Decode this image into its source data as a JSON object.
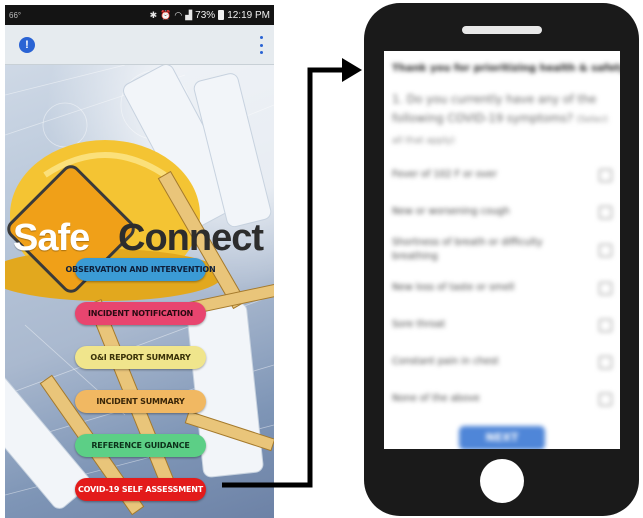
{
  "status_bar": {
    "left_text": "66°",
    "right_text": "73%",
    "time": "12:19 PM",
    "icons": [
      "bluetooth-icon",
      "alarm-icon",
      "wifi-icon",
      "signal-icon",
      "battery-icon"
    ]
  },
  "app_bar": {
    "left_icon": "info-icon",
    "right_icon": "more-vert-icon",
    "accent_color": "#2a63d4"
  },
  "logo": {
    "word_safe": "Safe",
    "word_connect": "Connect",
    "diamond_color": "#f0a018"
  },
  "menu": {
    "items": [
      {
        "label": "OBSERVATION AND INTERVENTION",
        "color": "#3b9bd5"
      },
      {
        "label": "INCIDENT NOTIFICATION",
        "color": "#e8456f"
      },
      {
        "label": "O&I REPORT SUMMARY",
        "color": "#f0e58c"
      },
      {
        "label": "INCIDENT SUMMARY",
        "color": "#f1b862"
      },
      {
        "label": "REFERENCE GUIDANCE",
        "color": "#5ccf86"
      },
      {
        "label": "COVID-19  SELF ASSESSMENT",
        "color": "#e31b1b"
      }
    ]
  },
  "survey": {
    "heading": "Thank you for prioritizing health & safety!",
    "question": "1. Do you currently have any of the following COVID-19 symptoms?",
    "hint": "(Select all that apply)",
    "options": [
      "Fever of 102 F or over",
      "New or worsening cough",
      "Shortness of breath or difficulty breathing",
      "New loss of taste or smell",
      "Sore throat",
      "Constant pain in chest",
      "None of the above"
    ],
    "next_label": "NEXT",
    "next_color": "#4f86d8"
  }
}
